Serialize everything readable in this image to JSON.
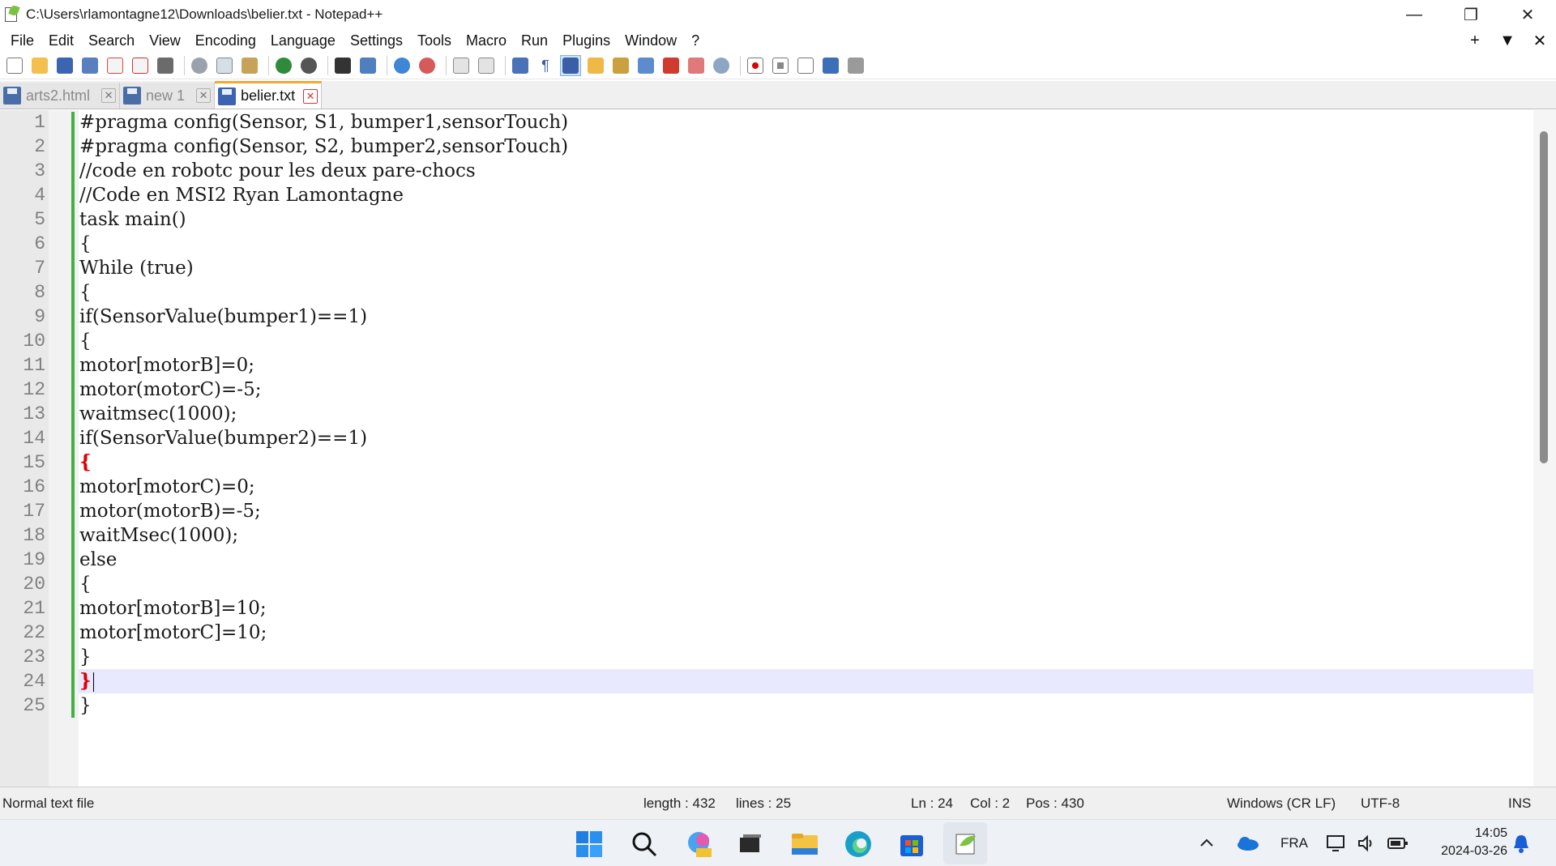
{
  "window": {
    "title": "C:\\Users\\rlamontagne12\\Downloads\\belier.txt - Notepad++",
    "minimize": "—",
    "maximize": "❐",
    "close": "✕"
  },
  "menu": {
    "items": [
      "File",
      "Edit",
      "Search",
      "View",
      "Encoding",
      "Language",
      "Settings",
      "Tools",
      "Macro",
      "Run",
      "Plugins",
      "Window",
      "?"
    ],
    "right": [
      "+",
      "▼",
      "✕"
    ]
  },
  "toolbar": {
    "icons": [
      "new-file-icon",
      "open-file-icon",
      "save-icon",
      "save-all-icon",
      "close-icon",
      "close-all-icon",
      "print-icon",
      "cut-icon",
      "copy-icon",
      "paste-icon",
      "undo-icon",
      "redo-icon",
      "find-icon",
      "replace-icon",
      "zoom-in-icon",
      "zoom-out-icon",
      "sync-vertical-icon",
      "sync-horizontal-icon",
      "word-wrap-icon",
      "show-all-chars-icon",
      "indent-guide-icon",
      "udl-icon",
      "doc-map-icon",
      "doc-list-icon",
      "function-list-icon",
      "folder-workspace-icon",
      "monitoring-icon",
      "record-macro-icon",
      "stop-macro-icon",
      "play-macro-icon",
      "run-macro-multiple-icon",
      "save-macro-icon"
    ]
  },
  "tabs": [
    {
      "label": "arts2.html",
      "active": false
    },
    {
      "label": "new 1",
      "active": false
    },
    {
      "label": "belier.txt",
      "active": true
    }
  ],
  "editor": {
    "line_numbers": [
      "1",
      "2",
      "3",
      "4",
      "5",
      "6",
      "7",
      "8",
      "9",
      "10",
      "11",
      "12",
      "13",
      "14",
      "15",
      "16",
      "17",
      "18",
      "19",
      "20",
      "21",
      "22",
      "23",
      "24",
      "25"
    ],
    "lines": [
      "#pragma config(Sensor, S1, bumper1,sensorTouch)",
      "#pragma config(Sensor, S2, bumper2,sensorTouch)",
      "//code en robotc pour les deux pare-chocs",
      "//Code en MSI2 Ryan Lamontagne",
      "task main()",
      "{",
      "While (true)",
      "{",
      "if(SensorValue(bumper1)==1)",
      "{",
      "motor[motorB]=0;",
      "motor(motorC)=-5;",
      "waitmsec(1000);",
      "if(SensorValue(bumper2)==1)",
      "{",
      "motor[motorC)=0;",
      "motor(motorB)=-5;",
      "waitMsec(1000);",
      "else",
      "{",
      "motor[motorB]=10;",
      "motor[motorC]=10;",
      "}",
      "}",
      "}"
    ],
    "current_line": 24,
    "brace_match_lines": [
      15,
      24
    ]
  },
  "status": {
    "file_type": "Normal text file",
    "length": "length : 432",
    "lines": "lines : 25",
    "ln": "Ln : 24",
    "col": "Col : 2",
    "pos": "Pos : 430",
    "eol": "Windows (CR LF)",
    "encoding": "UTF-8",
    "mode": "INS"
  },
  "taskbar": {
    "apps": [
      "windows-start-icon",
      "search-icon",
      "copilot-icon",
      "task-view-icon",
      "file-explorer-icon",
      "edge-icon",
      "store-icon",
      "notepadpp-icon"
    ],
    "language": "FRA",
    "time": "14:05",
    "date": "2024-03-26",
    "tray_chevron": "^"
  },
  "colors": {
    "accent_tab": "#f7a634",
    "change_bar": "#3fb23f",
    "brace_match": "#e00000",
    "current_line": "#e8e8ff"
  }
}
